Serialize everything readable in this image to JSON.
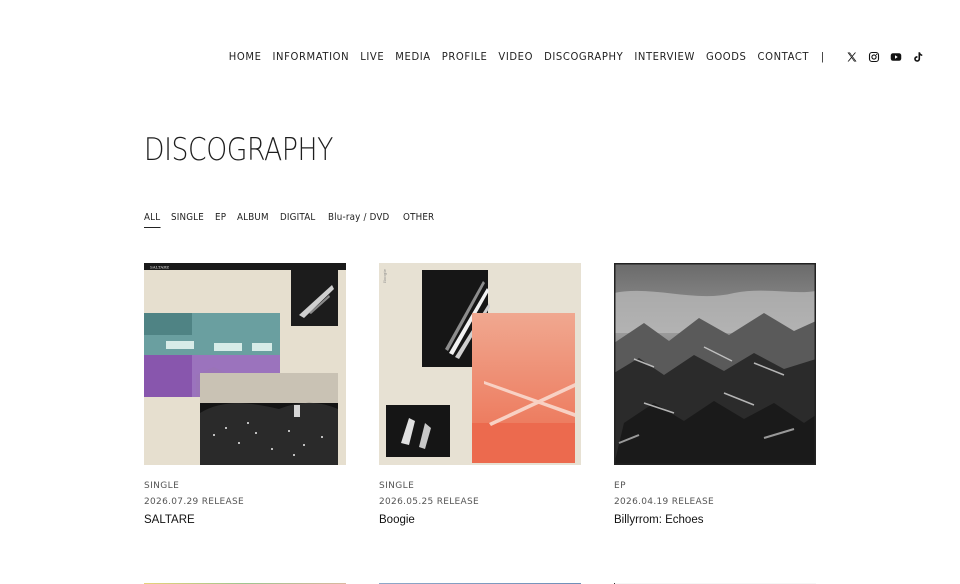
{
  "nav": {
    "items": [
      "HOME",
      "INFORMATION",
      "LIVE",
      "MEDIA",
      "PROFILE",
      "VIDEO",
      "DISCOGRAPHY",
      "INTERVIEW",
      "GOODS",
      "CONTACT"
    ],
    "separator": "|",
    "social_icons": [
      "x-icon",
      "instagram-icon",
      "youtube-icon",
      "tiktok-icon"
    ]
  },
  "page": {
    "title": "DISCOGRAPHY"
  },
  "filters": {
    "items": [
      "ALL",
      "SINGLE",
      "EP",
      "ALBUM",
      "DIGITAL",
      "Blu-ray / DVD",
      "OTHER"
    ],
    "active": "ALL"
  },
  "releases": [
    {
      "type": "SINGLE",
      "date": "2026.07.29 RELEASE",
      "title": "SALTARE",
      "cover_text": "SALTARE"
    },
    {
      "type": "SINGLE",
      "date": "2026.05.25 RELEASE",
      "title": "Boogie",
      "cover_text": "Boogie"
    },
    {
      "type": "EP",
      "date": "2026.04.19 RELEASE",
      "title": "Billyrrom: Echoes"
    }
  ],
  "colors": {
    "text": "#1a1a1a",
    "meta": "#555555",
    "cream": "#e8e2d4",
    "purple": "#8a5aae",
    "teal": "#5e9596",
    "salmon": "#ec7a5e"
  }
}
